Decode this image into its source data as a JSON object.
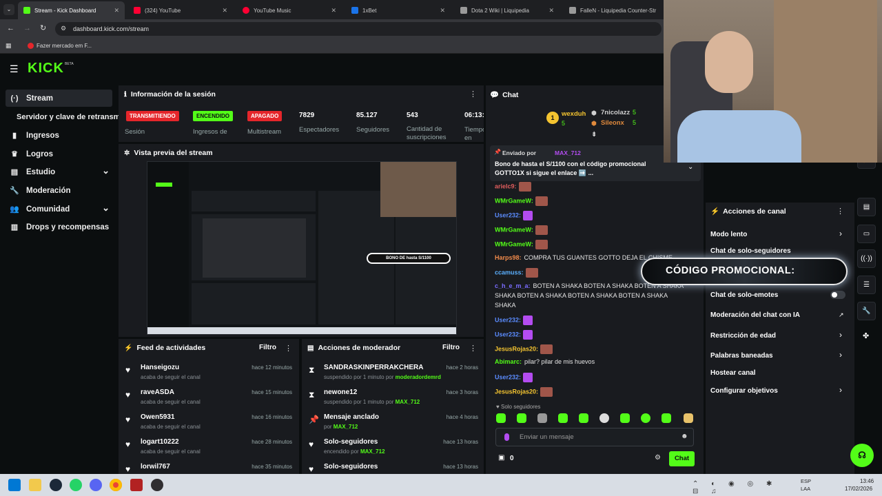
{
  "browser": {
    "tabs": [
      {
        "label": "Stream - Kick Dashboard",
        "color": "#53fc18",
        "active": true
      },
      {
        "label": "(324) YouTube",
        "color": "#ff0033"
      },
      {
        "label": "YouTube Music",
        "color": "#ff0033"
      },
      {
        "label": "1xBet",
        "color": "#1a73e8"
      },
      {
        "label": "Dota 2 Wiki | Liquipedia",
        "color": "#aaaaaa"
      },
      {
        "label": "FalleN - Liquipedia Counter-Str",
        "color": "#aaaaaa"
      }
    ],
    "url": "dashboard.kick.com/stream",
    "bookmark": "Fazer mercado em F..."
  },
  "kick": {
    "logo": "KICK",
    "logo_sup": "BETA",
    "sidebar": [
      {
        "label": "Stream",
        "icon": "stream-icon"
      },
      {
        "label": "Servidor y clave de retransm",
        "icon": ""
      },
      {
        "label": "Ingresos",
        "icon": "money-icon"
      },
      {
        "label": "Logros",
        "icon": "trophy-icon"
      },
      {
        "label": "Estudio",
        "icon": "studio-icon",
        "chevron": "⌄"
      },
      {
        "label": "Moderación",
        "icon": "wrench-icon"
      },
      {
        "label": "Comunidad",
        "icon": "people-icon",
        "chevron": "⌄"
      },
      {
        "label": "Drops y recompensas",
        "icon": "gift-icon"
      }
    ]
  },
  "session": {
    "title": "Información de la sesión",
    "badges": [
      {
        "label": "TRANSMITIENDO",
        "caption": "Sesión",
        "bg": "#e5262b",
        "fg": "#ffffff"
      },
      {
        "label": "ENCENDIDO",
        "caption": "Ingresos de Sesión",
        "bg": "#53fc18",
        "fg": "#0b0e0f"
      },
      {
        "label": "APAGADO",
        "caption": "Multistream",
        "bg": "#e5262b",
        "fg": "#ffffff"
      }
    ],
    "stats": [
      {
        "value": "7829",
        "label": "Espectadores"
      },
      {
        "value": "85.127",
        "label": "Seguidores"
      },
      {
        "value": "543",
        "label": "Cantidad de suscripciones"
      },
      {
        "value": "06:13:",
        "label": "Tiempo en vivo"
      }
    ]
  },
  "preview": {
    "title": "Vista previa del stream",
    "overlay": "BONO DE hasta S/1100"
  },
  "feed": {
    "title": "Feed de actividades",
    "filter": "Filtro",
    "rows": [
      {
        "name": "Hanseigozu",
        "sub": "acaba de seguir el canal",
        "time": "hace 12 minutos"
      },
      {
        "name": "raveASDA",
        "sub": "acaba de seguir el canal",
        "time": "hace 15 minutos"
      },
      {
        "name": "Owen5931",
        "sub": "acaba de seguir el canal",
        "time": "hace 16 minutos"
      },
      {
        "name": "logart10222",
        "sub": "acaba de seguir el canal",
        "time": "hace 28 minutos"
      },
      {
        "name": "lorwil767",
        "sub": "",
        "time": "hace 35 minutos"
      }
    ]
  },
  "modactions": {
    "title": "Acciones de moderador",
    "filter": "Filtro",
    "rows": [
      {
        "name": "SANDRASKINPERRAKCHERA",
        "sub": "suspendido por 1 minuto por",
        "by": "moderadordemrd",
        "time": "hace 2 horas",
        "icon": "hourglass-icon"
      },
      {
        "name": "newone12",
        "sub": "suspendido por 1 minuto por",
        "by": "MAX_712",
        "time": "hace 3 horas",
        "icon": "hourglass-icon"
      },
      {
        "name": "Mensaje anclado",
        "sub": "por",
        "by": "MAX_712",
        "time": "hace 4 horas",
        "icon": "pin-icon"
      },
      {
        "name": "Solo-seguidores",
        "sub": "encendido por",
        "by": "MAX_712",
        "time": "hace 13 horas",
        "icon": "heart-icon"
      },
      {
        "name": "Solo-seguidores",
        "sub": "",
        "by": "",
        "time": "hace 13 horas",
        "icon": "heart-icon"
      }
    ]
  },
  "chat": {
    "title": "Chat",
    "leaders": [
      {
        "name": "wexduh",
        "count": "5",
        "color": "#f4c430"
      },
      {
        "name": "7nicolazz",
        "count": "5",
        "color": "#cfcfcf"
      },
      {
        "name": "Sileonx",
        "count": "5",
        "color": "#e08a3c"
      }
    ],
    "pinned_by_label": "Enviado por",
    "pinned_by": "MAX_712",
    "pinned_text": "Bono de hasta el S/1100 con el código promocional GOTTO1X si sigue el enlace ➡️ ...",
    "messages": [
      {
        "user": "arielc9:",
        "color": "#e05d5d",
        "text": "",
        "emotes": 1
      },
      {
        "user": "WMrGameW:",
        "color": "#53fc18",
        "text": "",
        "emotes": 1
      },
      {
        "user": "User232:",
        "color": "#5b8cff",
        "text": "",
        "emotes": 1,
        "purple": true
      },
      {
        "user": "WMrGameW:",
        "color": "#53fc18",
        "text": "",
        "emotes": 1
      },
      {
        "user": "WMrGameW:",
        "color": "#53fc18",
        "text": "",
        "emotes": 1
      },
      {
        "user": "Harps98:",
        "color": "#f08a4b",
        "text": "COMPRA TUS GUANTES GOTTO DEJA EL CHISME",
        "emotes": 0
      },
      {
        "user": "ccamuss:",
        "color": "#5bb0ff",
        "text": "",
        "emotes": 1
      },
      {
        "user": "c_h_e_m_a:",
        "color": "#7a6cff",
        "text": "BOTEN A SHAKA   BOTEN A SHAKA   BOTEN A SHAKA",
        "emotes": 0
      },
      {
        "user": "",
        "color": "#ffffff",
        "text": "SHAKA   BOTEN A SHAKA   BOTEN A SHAKA   BOTEN A SHAKA",
        "emotes": 0
      },
      {
        "user": "",
        "color": "#ffffff",
        "text": "SHAKA",
        "emotes": 0
      },
      {
        "user": "User232:",
        "color": "#5b8cff",
        "text": "",
        "emotes": 1,
        "purple": true
      },
      {
        "user": "User232:",
        "color": "#5b8cff",
        "text": "",
        "emotes": 1,
        "purple": true
      },
      {
        "user": "JesusRojas20:",
        "color": "#f4c430",
        "text": "",
        "emotes": 1
      },
      {
        "user": "Abimarc:",
        "color": "#53fc18",
        "text": "pilar? pilar de mis huevos",
        "emotes": 0
      },
      {
        "user": "User232:",
        "color": "#5b8cff",
        "text": "",
        "emotes": 1,
        "purple": true
      },
      {
        "user": "JesusRojas20:",
        "color": "#f4c430",
        "text": "",
        "emotes": 1
      }
    ],
    "followers_only": "Solo seguidores",
    "placeholder": "Enviar un mensaje",
    "points": "0",
    "send_label": "Chat"
  },
  "channel_actions": {
    "title": "Acciones de canal",
    "items": [
      {
        "label": "Modo lento",
        "type": "chevron"
      },
      {
        "label": "Chat de solo-seguidores",
        "type": "chevron"
      },
      {
        "label": "Chat de solo-emotes",
        "type": "toggle"
      },
      {
        "label": "Moderación del chat con IA",
        "type": "external"
      },
      {
        "label": "Restricción de edad",
        "type": "chevron"
      },
      {
        "label": "Palabras baneadas",
        "type": "chevron"
      },
      {
        "label": "Hostear canal",
        "type": "none"
      },
      {
        "label": "Configurar objetivos",
        "type": "chevron"
      }
    ],
    "promo_banner": "CÓDIGO PROMOCIONAL:"
  },
  "taskbar": {
    "lang_top": "ESP",
    "lang_bottom": "LAA",
    "time": "13:46",
    "date": "17/02/2026"
  }
}
